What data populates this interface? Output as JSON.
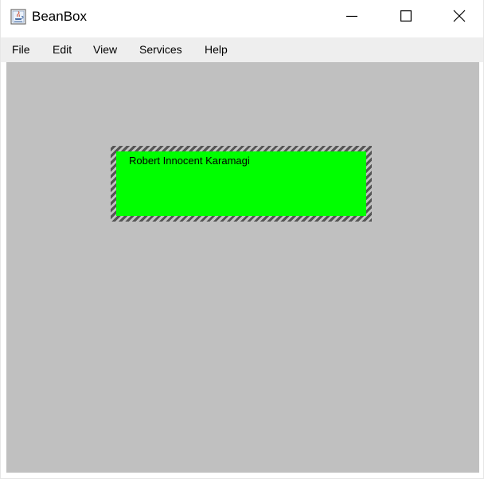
{
  "window": {
    "title": "BeanBox",
    "app_icon": "java-icon",
    "controls": {
      "minimize_icon": "minimize-icon",
      "maximize_icon": "maximize-icon",
      "close_icon": "close-icon"
    }
  },
  "menubar": {
    "items": [
      {
        "label": "File"
      },
      {
        "label": "Edit"
      },
      {
        "label": "View"
      },
      {
        "label": "Services"
      },
      {
        "label": "Help"
      }
    ]
  },
  "canvas": {
    "background": "#c0c0c0",
    "bean": {
      "text": "Robert Innocent Karamagi",
      "background": "#00ff00",
      "selected": true
    }
  }
}
